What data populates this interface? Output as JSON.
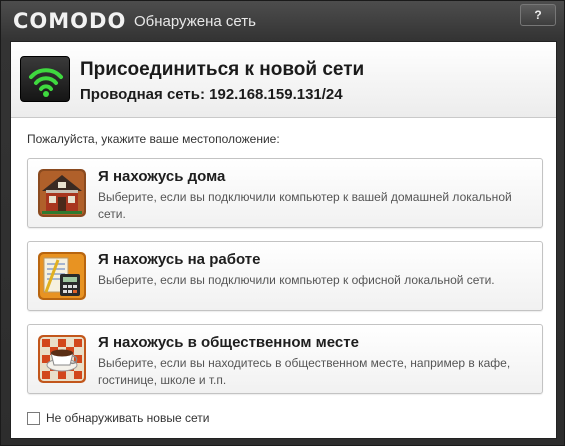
{
  "titlebar": {
    "logo": "COMODO",
    "title": "Обнаружена сеть",
    "help_label": "?"
  },
  "header": {
    "title": "Присоединиться к новой сети",
    "subtitle": "Проводная сеть: 192.168.159.131/24"
  },
  "prompt": "Пожалуйста, укажите ваше местоположение:",
  "options": [
    {
      "title": "Я нахожусь дома",
      "description": "Выберите, если вы подключили компьютер к вашей домашней локальной сети.",
      "icon": "home-icon"
    },
    {
      "title": "Я нахожусь на работе",
      "description": "Выберите, если вы подключили компьютер к офисной локальной сети.",
      "icon": "work-icon"
    },
    {
      "title": "Я нахожусь в общественном месте",
      "description": "Выберите, если вы находитесь в общественном месте, например в кафе, гостинице, школе и т.п.",
      "icon": "public-place-icon"
    }
  ],
  "checkbox": {
    "label": "Не обнаруживать новые сети",
    "checked": false
  },
  "colors": {
    "wifi_green": "#3fd93f",
    "window_dark": "#333333"
  }
}
